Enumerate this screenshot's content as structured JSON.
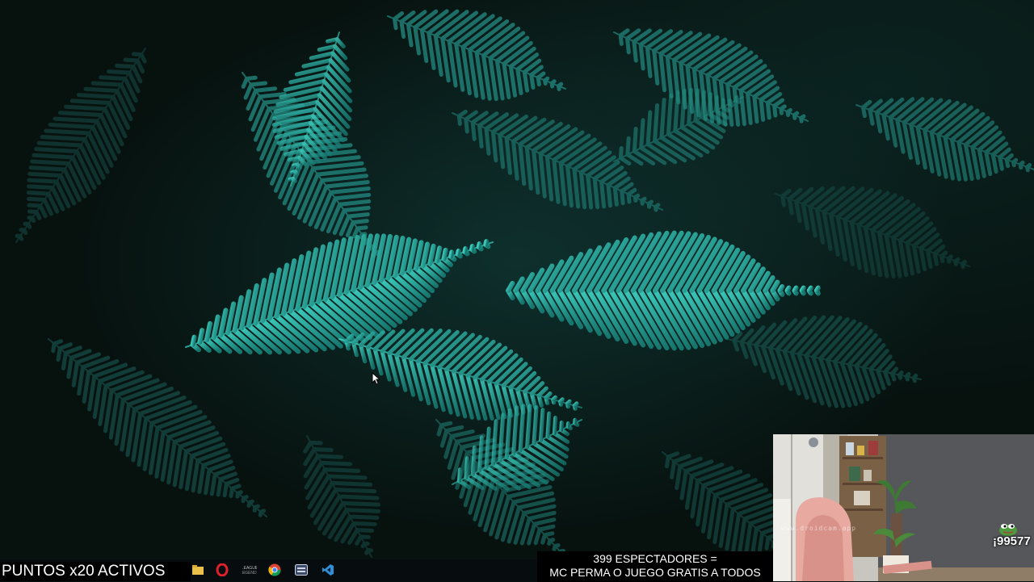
{
  "overlay": {
    "points_text": "PUNTOS x20 ACTIVOS",
    "viewers_line1": "399 ESPECTADORES =",
    "viewers_line2": "MC PERMA O JUEGO GRATIS A TODOS"
  },
  "webcam": {
    "watermark": "www.droidcam.app",
    "coin_count": "¡99577"
  },
  "taskbar": {
    "icons": [
      "file-explorer-icon",
      "opera-icon",
      "league-of-legends-icon",
      "chrome-icon",
      "app-window-icon",
      "visual-studio-code-icon"
    ]
  },
  "colors": {
    "fern": "#2aa59a",
    "background": "#07120f",
    "banner_bg": "#000000",
    "banner_text": "#ffffff"
  }
}
